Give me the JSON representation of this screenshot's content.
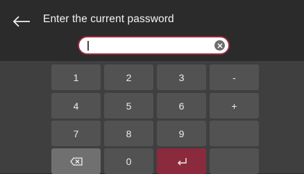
{
  "header": {
    "title": "Enter the current password",
    "back_icon": "arrow-left-icon"
  },
  "password_field": {
    "value": "",
    "clear_icon": "clear-circle-icon",
    "border_color": "#9b2a3e"
  },
  "keypad": {
    "keys": [
      "1",
      "2",
      "3",
      "-",
      "4",
      "5",
      "6",
      "+",
      "7",
      "8",
      "9",
      "",
      "",
      "0",
      ""
    ],
    "backspace_icon": "backspace-icon",
    "enter_icon": "enter-return-icon",
    "enter_color": "#8a2a3c"
  }
}
